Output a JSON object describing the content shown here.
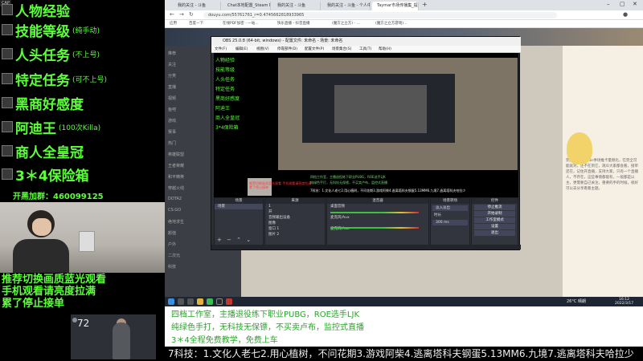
{
  "overlay": {
    "badge": "CAP",
    "tasks": [
      {
        "label": "人物经验",
        "note": ""
      },
      {
        "label": "技能等级",
        "note": "(纯手动)"
      },
      {
        "label": "人头任务",
        "note": "(不上号)"
      },
      {
        "label": "特定任务",
        "note": "(可不上号)"
      },
      {
        "label": "黑商好感度",
        "note": ""
      },
      {
        "label": "阿迪王",
        "note": "(100次Killa)"
      },
      {
        "label": "商人全皇冠",
        "note": ""
      },
      {
        "label": "3＊4保险箱",
        "note": ""
      }
    ],
    "open_group": "开黑加群：460099125"
  },
  "notice": [
    "推荐切换画质蓝光观看",
    "手机观看请亮度拉满",
    "累了停止接单"
  ],
  "character_card": {
    "score": "72"
  },
  "browser": {
    "tabs": [
      "我的关注 - 斗鱼",
      "Chat本地配置_Steam Ne...",
      "我的关注 - 斗鱼",
      "我的关注 - 斗鱼 - 个人中心 - 斗鱼",
      "Taymar市场传播集_提载剖析斗鱼..."
    ],
    "url": "douyu.com/55761761_r=0.4745662818933965",
    "bookmarks": [
      "应用",
      "百度一下",
      "在线PDF加密 - 一站...",
      "快乐直播 - 抖音直播",
      "(魔方之立方) - ...",
      "(魔方之立方游戏)..."
    ]
  },
  "site_sidebar": {
    "items": [
      "推荐",
      "关注",
      "分类",
      "直播",
      "视频",
      "鱼吧",
      "游戏",
      "赛事",
      "热门",
      "英雄联盟",
      "王者荣耀",
      "和平精英",
      "穿越火线",
      "DOTA2",
      "CS:GO",
      "绝地求生",
      "颜值",
      "户外",
      "二次元",
      "科技"
    ]
  },
  "chat": {
    "text": "完美快乐Taymar季场推卡量频比，在完全可能就对，还不在到它，观众大家都会看，接单还在，记住开直播，支持大家，只有一个直播人，不存在，这些事情都能有，一般都是以主，更需要自己关注，重要的手的时候，很好可以去分享看看主题。"
  },
  "obs": {
    "title": "OBS 25.0.8 (64-bit, windows) - 配置文件: 未命名 - 场景: 未命名",
    "menu": [
      "文件(F)",
      "编辑(E)",
      "视图(V)",
      "停靠部件(D)",
      "配置文件(P)",
      "场景集合(S)",
      "工具(T)",
      "帮助(H)"
    ],
    "preview_green": [
      "人物经验",
      "技能等级",
      "人头任务",
      "特定任务",
      "黑商好感度",
      "阿迪王",
      "商人全皇冠",
      "3*4保险箱"
    ],
    "preview_red": "推荐切换画质蓝光观看 手机观看请亮度拉满 累了停止接单",
    "preview_lower": [
      "四档工作室，主播退役练下职业PUBG，ROE选手LJK",
      "纯绿色手打，无科技无保镖，不买卖卢布，监控式直播",
      "7科技：1.文化人老七2.用心植树，不问花期3.游戏阿柴4.逃离塔科夫钢蛋5.13MM6.九境7.逃离塔科夫哈拉少"
    ],
    "docks": {
      "scenes_title": "场景",
      "scenes": [
        "场景"
      ],
      "sources_title": "来源",
      "sources": [
        "1",
        "开",
        "音频输出设备",
        "图像",
        "窗口 1",
        "图片 2"
      ],
      "mixer_title": "混音器",
      "mixer": [
        "桌面音频",
        "麦克风/Aux",
        "麦克风/Aux"
      ],
      "transitions_title": "场景转场",
      "transition": "淡入淡出",
      "duration_label": "时长",
      "duration": "300 ms",
      "controls_title": "控件",
      "controls": [
        "停止推流",
        "开始录制",
        "工作室模式",
        "设置",
        "退出"
      ]
    }
  },
  "taskbar": {
    "weather": "26°C 晴朗",
    "time": "16:12",
    "date": "2022/3/17"
  },
  "info": {
    "line1": "四档工作室，主播退役练下职业PUBG，ROE选手LJK",
    "line2": "纯绿色手打，无科技无保镖，不买卖卢布，监控式直播",
    "line3": "3＊4全程免费教学，免费上车"
  },
  "marquee": "7科技：1.文化人老七2.用心植树，不问花期3.游戏阿柴4.逃离塔科夫钢蛋5.13MM6.九境7.逃离塔科夫哈拉少",
  "colors": {
    "overlay_green": "#5cff3a",
    "info_green": "#2aa52a"
  }
}
